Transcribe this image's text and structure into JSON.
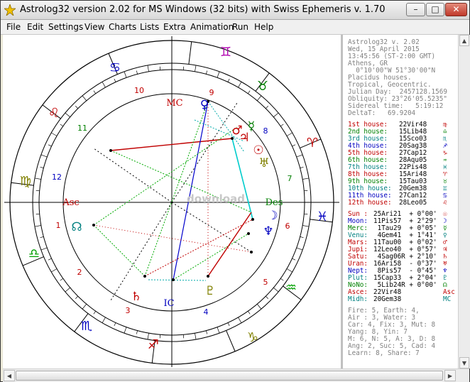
{
  "window": {
    "title": "Astrolog32 version 2.02 for MS Windows (32 bits) with Swiss Ephemeris v. 1.70",
    "min_label": "–",
    "max_label": "□",
    "close_label": "✕"
  },
  "menu": [
    "File",
    "Edit",
    "Settings",
    "View",
    "Charts",
    "Lists",
    "Extra",
    "Animation",
    "Run",
    "Help"
  ],
  "chart": {
    "house_numbers": [
      "1",
      "2",
      "3",
      "4",
      "5",
      "6",
      "7",
      "8",
      "9",
      "10",
      "11",
      "12"
    ],
    "asc_label": "Asc",
    "des_label": "Des",
    "mc_label": "MC",
    "ic_label": "IC",
    "watermark": "download"
  },
  "info": {
    "header": [
      "Astrolog32 v. 2.02",
      "Wed, 15 April 2015",
      "13:45:56 (ST-2:00 GMT)",
      "Athens, GR",
      "  0°10'00\"W 51°30'00\"N",
      "Placidus houses.",
      "Tropical, Geocentric.",
      "Julian Day:  2457128.1569",
      "Obliquity: 23°26'05.5235\"",
      "Sidereal time:   5:19:12",
      "DeltaT:   69.9204"
    ],
    "houses": [
      {
        "label": "1st house:",
        "value": "22Vir48",
        "glyph": "♍",
        "color": "c-red"
      },
      {
        "label": "2nd house:",
        "value": "15Lib48",
        "glyph": "♎",
        "color": "c-green"
      },
      {
        "label": "3rd house:",
        "value": "15Sco03",
        "glyph": "♏",
        "color": "c-teal"
      },
      {
        "label": "4th house:",
        "value": "20Sag38",
        "glyph": "♐",
        "color": "c-blue"
      },
      {
        "label": "5th house:",
        "value": "27Cap12",
        "glyph": "♑",
        "color": "c-red"
      },
      {
        "label": "6th house:",
        "value": "28Aqu05",
        "glyph": "♒",
        "color": "c-green"
      },
      {
        "label": "7th house:",
        "value": "22Pis48",
        "glyph": "♓",
        "color": "c-teal"
      },
      {
        "label": "8th house:",
        "value": "15Ari48",
        "glyph": "♈",
        "color": "c-red"
      },
      {
        "label": "9th house:",
        "value": "15Tau03",
        "glyph": "♉",
        "color": "c-green"
      },
      {
        "label": "10th house:",
        "value": "20Gem38",
        "glyph": "♊",
        "color": "c-teal"
      },
      {
        "label": "11th house:",
        "value": "27Can12",
        "glyph": "♋",
        "color": "c-blue"
      },
      {
        "label": "12th house:",
        "value": "28Leo05",
        "glyph": "♌",
        "color": "c-red"
      }
    ],
    "planets": [
      {
        "label": "Sun :",
        "value": "25Ari21  + 0°00'",
        "glyph": "☉",
        "color": "c-red"
      },
      {
        "label": "Moon:",
        "value": "11Pis57  + 2°29'",
        "glyph": "☽",
        "color": "c-blue"
      },
      {
        "label": "Merc:",
        "value": " 1Tau29  + 0°05'",
        "glyph": "☿",
        "color": "c-green"
      },
      {
        "label": "Venu:",
        "value": " 4Gem41  + 1°41'",
        "glyph": "♀",
        "color": "c-teal"
      },
      {
        "label": "Mars:",
        "value": "11Tau00  + 0°02'",
        "glyph": "♂",
        "color": "c-red"
      },
      {
        "label": "Jupi:",
        "value": "12Leo40  + 0°57'",
        "glyph": "♃",
        "color": "c-red"
      },
      {
        "label": "Satu:",
        "value": " 4Sag06R + 2°10'",
        "glyph": "♄",
        "color": "c-red"
      },
      {
        "label": "Uran:",
        "value": "16Ari58  - 0°37'",
        "glyph": "♅",
        "color": "c-red"
      },
      {
        "label": "Nept:",
        "value": " 8Pis57  - 0°45'",
        "glyph": "♆",
        "color": "c-blue"
      },
      {
        "label": "Plut:",
        "value": "15Cap33  + 2°04'",
        "glyph": "♇",
        "color": "c-teal"
      },
      {
        "label": "NoNo:",
        "value": " 5Lib24R + 0°00'",
        "glyph": "☊",
        "color": "c-green"
      },
      {
        "label": "Asce:",
        "value": "22Vir48",
        "glyph": "Asc",
        "color": "c-red"
      },
      {
        "label": "Midh:",
        "value": "20Gem38",
        "glyph": "MC",
        "color": "c-teal"
      }
    ],
    "summary": [
      "Fire: 5, Earth: 4,",
      "Air : 3, Water: 3",
      "Car: 4, Fix: 3, Mut: 8",
      "Yang: 8, Yin: 7",
      "M: 6, N: 5, A: 3, D: 8",
      "Ang: 2, Suc: 5, Cad: 4",
      "Learn: 8, Share: 7"
    ]
  },
  "scroll": {
    "up": "▲",
    "down": "▼",
    "left": "◀",
    "right": "▶"
  }
}
